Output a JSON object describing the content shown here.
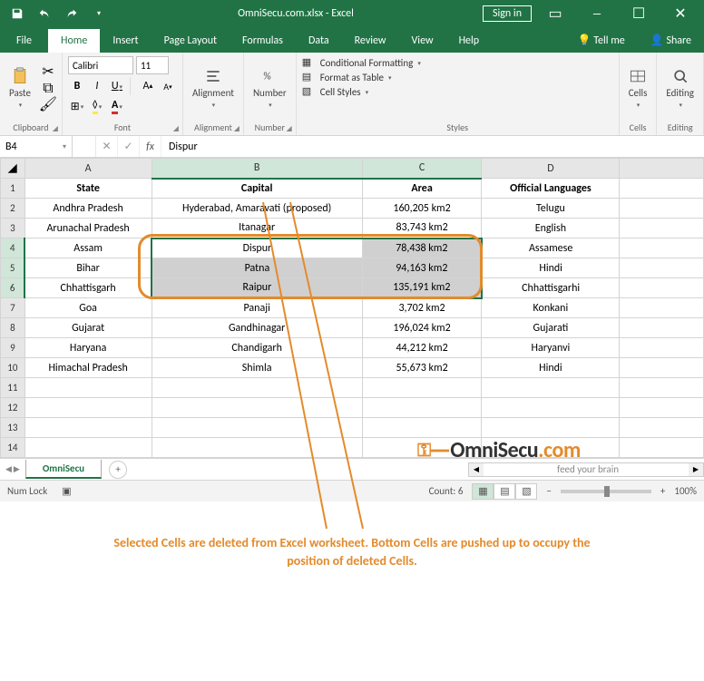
{
  "title": "OmniSecu.com.xlsx - Excel",
  "sign_in": "Sign in",
  "tabs": {
    "file": "File",
    "home": "Home",
    "insert": "Insert",
    "page_layout": "Page Layout",
    "formulas": "Formulas",
    "data": "Data",
    "review": "Review",
    "view": "View",
    "help": "Help",
    "tell_me": "Tell me",
    "share": "Share"
  },
  "ribbon": {
    "clipboard": {
      "paste": "Paste",
      "label": "Clipboard"
    },
    "font": {
      "name": "Calibri",
      "size": "11",
      "label": "Font",
      "bold": "B",
      "italic": "I",
      "underline": "U",
      "grow": "A",
      "shrink": "A"
    },
    "alignment": {
      "label": "Alignment",
      "btn": "Alignment"
    },
    "number": {
      "label": "Number",
      "btn": "Number"
    },
    "styles": {
      "label": "Styles",
      "cond": "Conditional Formatting",
      "table": "Format as Table",
      "cell": "Cell Styles"
    },
    "cells": {
      "label": "Cells",
      "btn": "Cells"
    },
    "editing": {
      "label": "Editing",
      "btn": "Editing"
    }
  },
  "name_box": "B4",
  "fx": "fx",
  "formula": "Dispur",
  "columns": [
    "A",
    "B",
    "C",
    "D"
  ],
  "col_widths": [
    "col-a",
    "col-b",
    "col-c",
    "col-d",
    "col-e"
  ],
  "headers": [
    "State",
    "Capital",
    "Area",
    "Official Languages"
  ],
  "rows": [
    [
      "Andhra Pradesh",
      "Hyderabad, Amaravati (proposed)",
      "160,205 km2",
      "Telugu"
    ],
    [
      "Arunachal Pradesh",
      "Itanagar",
      "83,743 km2",
      "English"
    ],
    [
      "Assam",
      "Dispur",
      "78,438 km2",
      "Assamese"
    ],
    [
      "Bihar",
      "Patna",
      "94,163 km2",
      "Hindi"
    ],
    [
      "Chhattisgarh",
      "Raipur",
      "135,191 km2",
      "Chhattisgarhi"
    ],
    [
      "Goa",
      "Panaji",
      "3,702 km2",
      "Konkani"
    ],
    [
      "Gujarat",
      "Gandhinagar",
      "196,024 km2",
      "Gujarati"
    ],
    [
      "Haryana",
      "Chandigarh",
      "44,212 km2",
      "Haryanvi"
    ],
    [
      "Himachal Pradesh",
      "Shimla",
      "55,673 km2",
      "Hindi"
    ]
  ],
  "empty_rows": [
    11,
    12,
    13,
    14
  ],
  "selection": {
    "first_row": 4,
    "last_row": 6,
    "first_col": "B",
    "last_col": "C"
  },
  "logo": {
    "brand": "OmniSecu",
    "tld": ".com",
    "tag": "feed your brain"
  },
  "sheet_tab": "OmniSecu",
  "status": {
    "numlock": "Num Lock",
    "count_label": "Count:",
    "count_val": "6",
    "zoom": "100%"
  },
  "caption": "Selected Cells are deleted from Excel worksheet. Bottom Cells are pushed up to occupy the position of deleted Cells."
}
